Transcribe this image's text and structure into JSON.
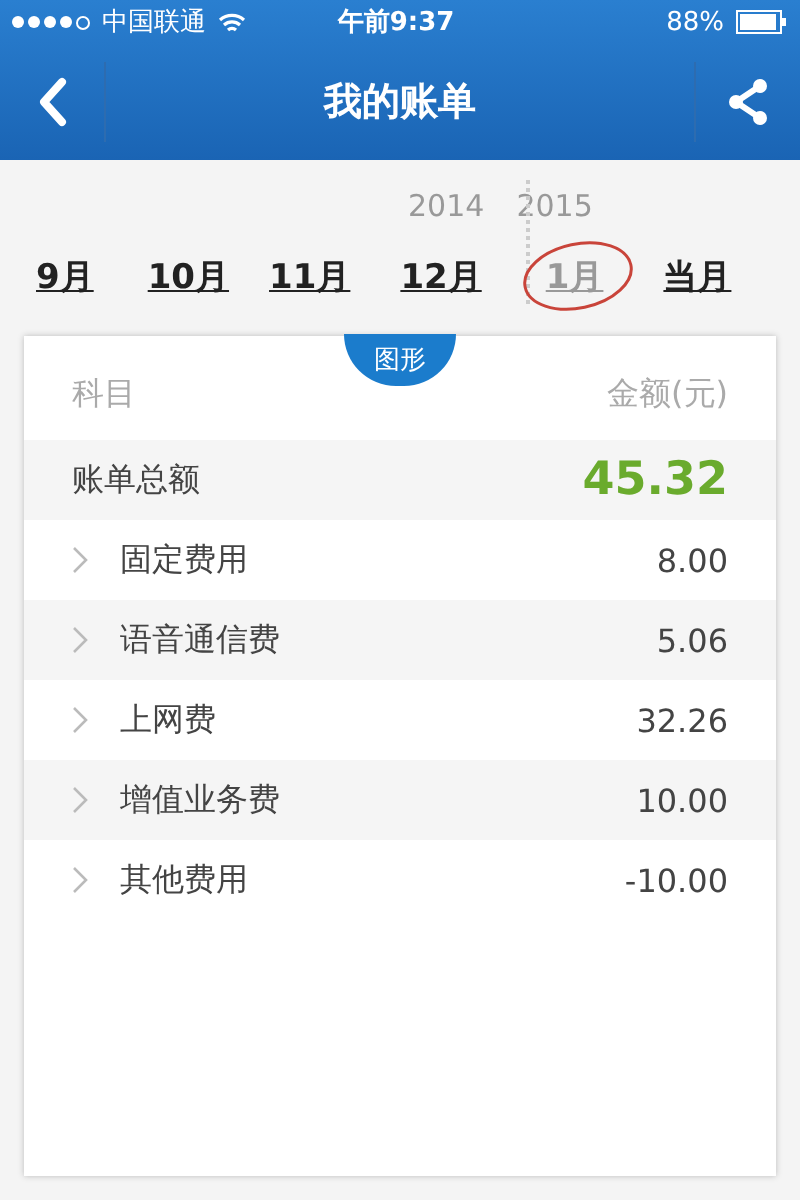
{
  "status_bar": {
    "carrier": "中国联通",
    "time": "午前9:37",
    "battery": "88%"
  },
  "nav": {
    "title": "我的账单"
  },
  "years": [
    "2014",
    "2015"
  ],
  "months": [
    {
      "label": "9月",
      "selected": false
    },
    {
      "label": "10月",
      "selected": false
    },
    {
      "label": "11月",
      "selected": false
    },
    {
      "label": "12月",
      "selected": false
    },
    {
      "label": "1月",
      "selected": true
    },
    {
      "label": "当月",
      "selected": false
    }
  ],
  "card": {
    "toggle": "图形",
    "column_headers": [
      "科目",
      "金额(元)"
    ],
    "total": {
      "label": "账单总额",
      "amount": "45.32"
    },
    "rows": [
      {
        "label": "固定费用",
        "amount": "8.00"
      },
      {
        "label": "语音通信费",
        "amount": "5.06"
      },
      {
        "label": "上网费",
        "amount": "32.26"
      },
      {
        "label": "增值业务费",
        "amount": "10.00"
      },
      {
        "label": "其他费用",
        "amount": "-10.00"
      }
    ]
  }
}
